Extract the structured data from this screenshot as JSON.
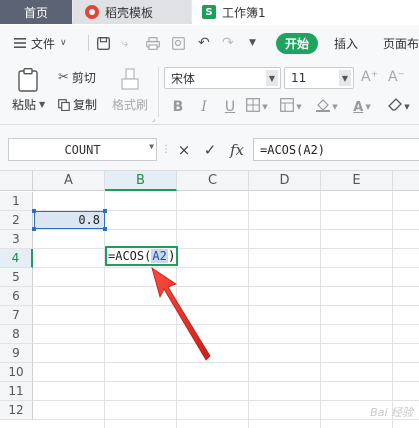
{
  "tabs": {
    "home": "首页",
    "template": "稻壳模板",
    "workbook": "工作簿1",
    "workbook_icon_letter": "S"
  },
  "menubar": {
    "file": "文件",
    "start": "开始",
    "insert": "插入",
    "page_layout": "页面布"
  },
  "ribbon": {
    "paste": "粘贴",
    "cut": "剪切",
    "copy": "复制",
    "format_painter": "格式刷",
    "font_name": "宋体",
    "font_size": "11",
    "grow_font": "A⁺",
    "shrink_font": "A⁻",
    "bold": "B",
    "italic": "I",
    "underline": "U"
  },
  "formula_bar": {
    "name_box": "COUNT",
    "cancel": "×",
    "confirm": "✓",
    "fx": "fx",
    "formula": "=ACOS(A2)"
  },
  "grid": {
    "columns": [
      "A",
      "B",
      "C",
      "D",
      "E"
    ],
    "rows": [
      "1",
      "2",
      "3",
      "4",
      "5",
      "6",
      "7",
      "8",
      "9",
      "10",
      "11",
      "12"
    ],
    "active_column": "B",
    "active_row": "4"
  },
  "cells": {
    "A2": "0.8",
    "B4_prefix": "=ACOS(",
    "B4_ref": "A2",
    "B4_suffix": ")"
  },
  "colors": {
    "accent_green": "#1ea45e",
    "selection_blue": "#2f6fc2",
    "annotation_red": "#e0302a"
  }
}
